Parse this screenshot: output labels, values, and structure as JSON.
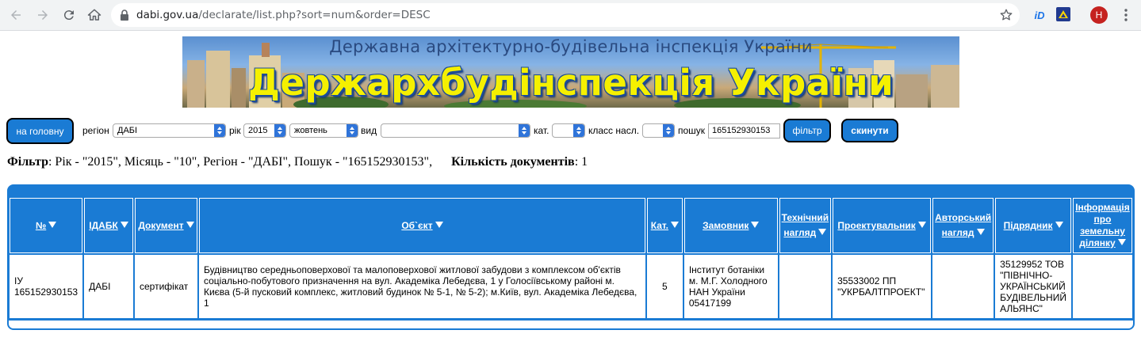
{
  "browser": {
    "url_host": "dabi.gov.ua",
    "url_path": "/declarate/list.php?sort=num&order=DESC",
    "ext_id_label": "iD",
    "avatar_letter": "H"
  },
  "banner": {
    "subtitle": "Державна архітектурно-будівельна інспекція України",
    "title": "Держархбудінспекція України"
  },
  "filters": {
    "home_button": "на головну",
    "region_label": "регіон",
    "region_value": "ДАБІ",
    "year_label": "рік",
    "year_value": "2015",
    "month_value": "жовтень",
    "type_label": "вид",
    "type_value": "",
    "category_label": "кат.",
    "category_value": "",
    "class_label": "класс насл.",
    "class_value": "",
    "search_label": "пошук",
    "search_value": "165152930153",
    "filter_button": "фільтр",
    "reset_button": "скинути"
  },
  "summary": {
    "filter_label": "Фільтр",
    "filter_text": ": Рік - \"2015\", Місяць - \"10\", Регіон - \"ДАБІ\", Пошук - \"165152930153\",",
    "count_label": "Кількість документів",
    "count_text": ": 1"
  },
  "table": {
    "headers": [
      "№",
      "ІДАБК",
      "Документ",
      "Об`єкт",
      "Кат.",
      "Замовник",
      "Технічний нагляд",
      "Проектувальник",
      "Авторський нагляд",
      "Підрядник",
      "Інформація про земельну ділянку"
    ],
    "rows": [
      [
        "ІУ 165152930153",
        "ДАБІ",
        "сертифікат",
        "Будівництво середньоповерхової та малоповерхової житлової забудови з комплексом об'єктів соціально-побутового призначення на вул. Академіка Лебедєва, 1 у Голосіївському районі м. Києва (5-й пусковий комплекс, житловий будинок № 5-1, № 5-2); м.Київ, вул. Академіка Лебедєва, 1",
        "5",
        "Інститут ботаніки м. М.Г. Холодного НАН України 05417199",
        "",
        "35533002 ПП \"УКРБАЛТПРОЕКТ\"",
        "",
        "35129952 ТОВ \"ПІВНІЧНО-УКРАЇНСЬКИЙ БУДІВЕЛЬНИЙ АЛЬЯНС\"",
        ""
      ]
    ]
  },
  "colors": {
    "accent": "#1a7bd4",
    "banner_title": "#f5f000"
  }
}
